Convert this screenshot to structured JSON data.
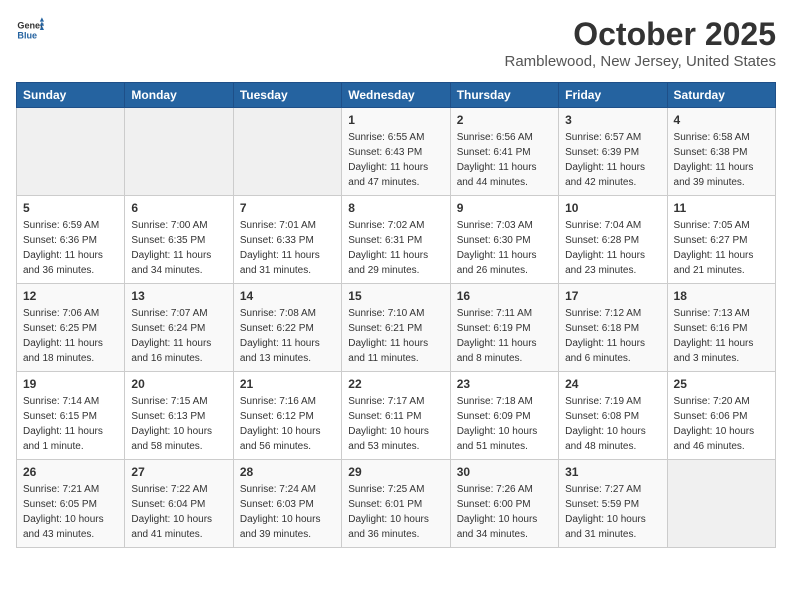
{
  "header": {
    "logo_line1": "General",
    "logo_line2": "Blue",
    "month": "October 2025",
    "location": "Ramblewood, New Jersey, United States"
  },
  "weekdays": [
    "Sunday",
    "Monday",
    "Tuesday",
    "Wednesday",
    "Thursday",
    "Friday",
    "Saturday"
  ],
  "weeks": [
    [
      {
        "day": "",
        "info": ""
      },
      {
        "day": "",
        "info": ""
      },
      {
        "day": "",
        "info": ""
      },
      {
        "day": "1",
        "info": "Sunrise: 6:55 AM\nSunset: 6:43 PM\nDaylight: 11 hours\nand 47 minutes."
      },
      {
        "day": "2",
        "info": "Sunrise: 6:56 AM\nSunset: 6:41 PM\nDaylight: 11 hours\nand 44 minutes."
      },
      {
        "day": "3",
        "info": "Sunrise: 6:57 AM\nSunset: 6:39 PM\nDaylight: 11 hours\nand 42 minutes."
      },
      {
        "day": "4",
        "info": "Sunrise: 6:58 AM\nSunset: 6:38 PM\nDaylight: 11 hours\nand 39 minutes."
      }
    ],
    [
      {
        "day": "5",
        "info": "Sunrise: 6:59 AM\nSunset: 6:36 PM\nDaylight: 11 hours\nand 36 minutes."
      },
      {
        "day": "6",
        "info": "Sunrise: 7:00 AM\nSunset: 6:35 PM\nDaylight: 11 hours\nand 34 minutes."
      },
      {
        "day": "7",
        "info": "Sunrise: 7:01 AM\nSunset: 6:33 PM\nDaylight: 11 hours\nand 31 minutes."
      },
      {
        "day": "8",
        "info": "Sunrise: 7:02 AM\nSunset: 6:31 PM\nDaylight: 11 hours\nand 29 minutes."
      },
      {
        "day": "9",
        "info": "Sunrise: 7:03 AM\nSunset: 6:30 PM\nDaylight: 11 hours\nand 26 minutes."
      },
      {
        "day": "10",
        "info": "Sunrise: 7:04 AM\nSunset: 6:28 PM\nDaylight: 11 hours\nand 23 minutes."
      },
      {
        "day": "11",
        "info": "Sunrise: 7:05 AM\nSunset: 6:27 PM\nDaylight: 11 hours\nand 21 minutes."
      }
    ],
    [
      {
        "day": "12",
        "info": "Sunrise: 7:06 AM\nSunset: 6:25 PM\nDaylight: 11 hours\nand 18 minutes."
      },
      {
        "day": "13",
        "info": "Sunrise: 7:07 AM\nSunset: 6:24 PM\nDaylight: 11 hours\nand 16 minutes."
      },
      {
        "day": "14",
        "info": "Sunrise: 7:08 AM\nSunset: 6:22 PM\nDaylight: 11 hours\nand 13 minutes."
      },
      {
        "day": "15",
        "info": "Sunrise: 7:10 AM\nSunset: 6:21 PM\nDaylight: 11 hours\nand 11 minutes."
      },
      {
        "day": "16",
        "info": "Sunrise: 7:11 AM\nSunset: 6:19 PM\nDaylight: 11 hours\nand 8 minutes."
      },
      {
        "day": "17",
        "info": "Sunrise: 7:12 AM\nSunset: 6:18 PM\nDaylight: 11 hours\nand 6 minutes."
      },
      {
        "day": "18",
        "info": "Sunrise: 7:13 AM\nSunset: 6:16 PM\nDaylight: 11 hours\nand 3 minutes."
      }
    ],
    [
      {
        "day": "19",
        "info": "Sunrise: 7:14 AM\nSunset: 6:15 PM\nDaylight: 11 hours\nand 1 minute."
      },
      {
        "day": "20",
        "info": "Sunrise: 7:15 AM\nSunset: 6:13 PM\nDaylight: 10 hours\nand 58 minutes."
      },
      {
        "day": "21",
        "info": "Sunrise: 7:16 AM\nSunset: 6:12 PM\nDaylight: 10 hours\nand 56 minutes."
      },
      {
        "day": "22",
        "info": "Sunrise: 7:17 AM\nSunset: 6:11 PM\nDaylight: 10 hours\nand 53 minutes."
      },
      {
        "day": "23",
        "info": "Sunrise: 7:18 AM\nSunset: 6:09 PM\nDaylight: 10 hours\nand 51 minutes."
      },
      {
        "day": "24",
        "info": "Sunrise: 7:19 AM\nSunset: 6:08 PM\nDaylight: 10 hours\nand 48 minutes."
      },
      {
        "day": "25",
        "info": "Sunrise: 7:20 AM\nSunset: 6:06 PM\nDaylight: 10 hours\nand 46 minutes."
      }
    ],
    [
      {
        "day": "26",
        "info": "Sunrise: 7:21 AM\nSunset: 6:05 PM\nDaylight: 10 hours\nand 43 minutes."
      },
      {
        "day": "27",
        "info": "Sunrise: 7:22 AM\nSunset: 6:04 PM\nDaylight: 10 hours\nand 41 minutes."
      },
      {
        "day": "28",
        "info": "Sunrise: 7:24 AM\nSunset: 6:03 PM\nDaylight: 10 hours\nand 39 minutes."
      },
      {
        "day": "29",
        "info": "Sunrise: 7:25 AM\nSunset: 6:01 PM\nDaylight: 10 hours\nand 36 minutes."
      },
      {
        "day": "30",
        "info": "Sunrise: 7:26 AM\nSunset: 6:00 PM\nDaylight: 10 hours\nand 34 minutes."
      },
      {
        "day": "31",
        "info": "Sunrise: 7:27 AM\nSunset: 5:59 PM\nDaylight: 10 hours\nand 31 minutes."
      },
      {
        "day": "",
        "info": ""
      }
    ]
  ]
}
